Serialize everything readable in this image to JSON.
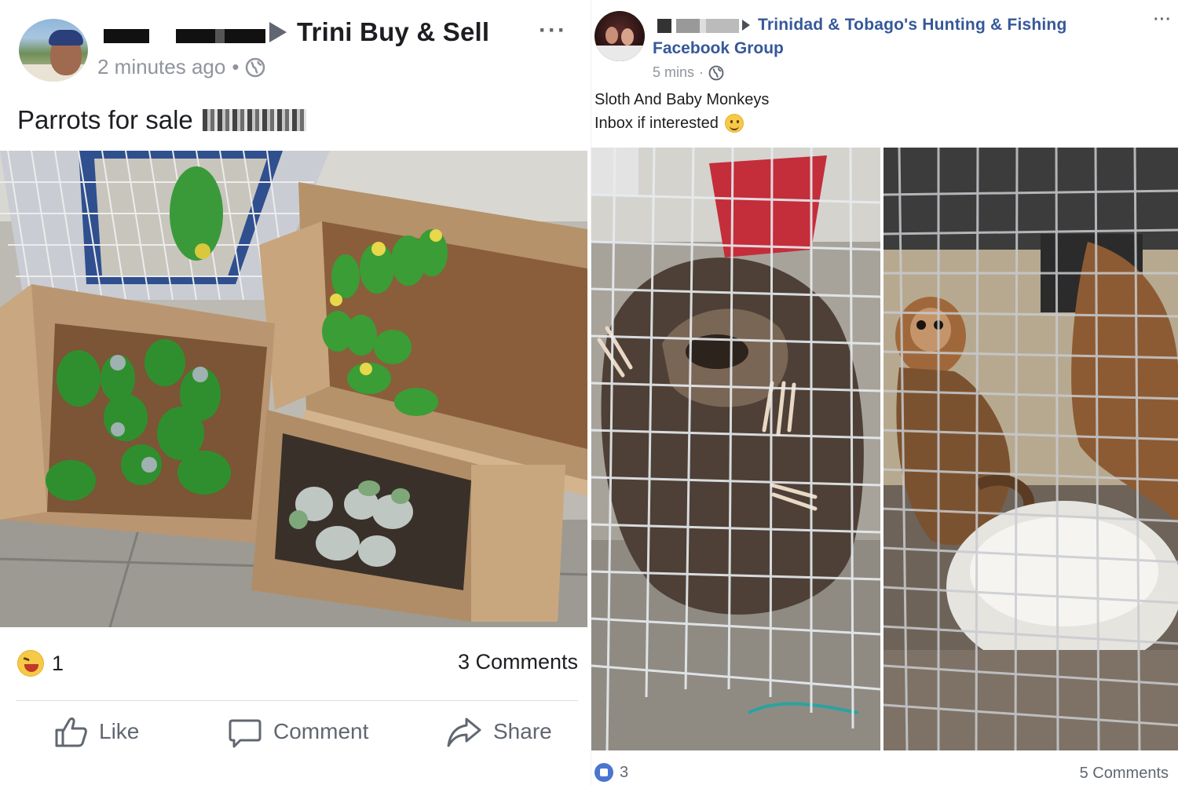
{
  "left_post": {
    "group_name": "Trini Buy & Sell",
    "timestamp": "2 minutes ago",
    "more": "···",
    "text": "Parrots for sale",
    "reaction_count": "1",
    "comments": "3 Comments",
    "actions": {
      "like": "Like",
      "comment": "Comment",
      "share": "Share"
    }
  },
  "right_post": {
    "group_name_line1": "Trinidad & Tobago's Hunting & Fishing",
    "group_name_line2": "Facebook Group",
    "timestamp": "5 mins",
    "more": "···",
    "text_line1": "Sloth And Baby Monkeys",
    "text_line2": "Inbox if interested",
    "reaction_count": "3",
    "comments": "5 Comments"
  },
  "colors": {
    "link_blue": "#365899",
    "secondary_text": "#90949c",
    "action_grey": "#606770"
  }
}
